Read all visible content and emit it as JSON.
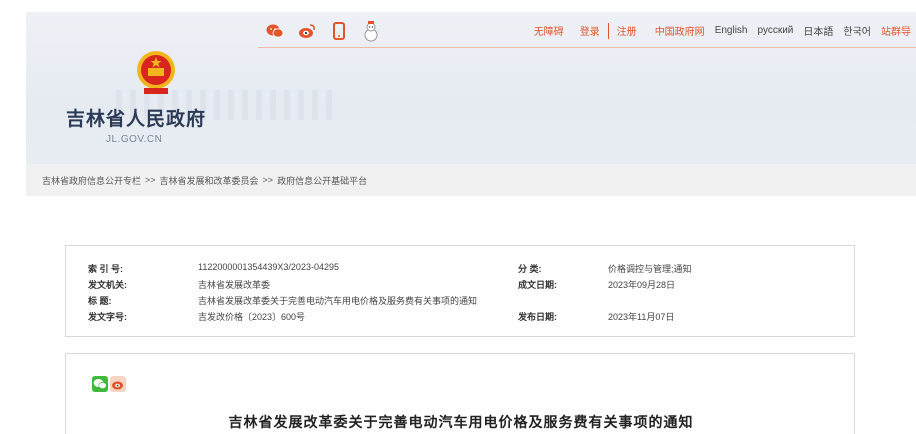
{
  "site": {
    "name": "吉林省人民政府",
    "domain": "JL.GOV.CN"
  },
  "topbar": {
    "icons": [
      "wechat-icon",
      "weibo-icon",
      "mobile-icon",
      "snowman-icon"
    ],
    "links": {
      "accessibility": "无障碍",
      "login": "登录",
      "register": "注册",
      "gov_cn": "中国政府网",
      "english": "English",
      "russian": "русский",
      "japanese": "日本語",
      "korean": "한국어",
      "station_group": "站群导"
    }
  },
  "breadcrumb": {
    "item1": "吉林省政府信息公开专栏",
    "sep": ">>",
    "item2": "吉林省发展和改革委员会",
    "item3": "政府信息公开基础平台"
  },
  "meta": {
    "index_label": "索 引 号:",
    "index_value": "11220000013544​39X3/2023-04295",
    "category_label": "分 类:",
    "category_value": "价格调控与管理;通知",
    "issuer_label": "发文机关:",
    "issuer_value": "吉林省发展改革委",
    "written_label": "成文日期:",
    "written_value": "2023年09月28日",
    "title_label": "标 题:",
    "title_value": "吉林省发展改革委关于完善电动汽车用电价格及服务费有关事项的通知",
    "docno_label": "发文字号:",
    "docno_value": "吉发改价格〔2023〕600号",
    "published_label": "发布日期:",
    "published_value": "2023年11月07日"
  },
  "content": {
    "title": "吉林省发展改革委关于完善电动汽车用电价格及服务费有关事项的通知"
  },
  "colors": {
    "accent": "#e2542a",
    "emblem_red": "#d8261f",
    "emblem_gold": "#f2b51c",
    "wechat_green": "#3fb83c"
  }
}
